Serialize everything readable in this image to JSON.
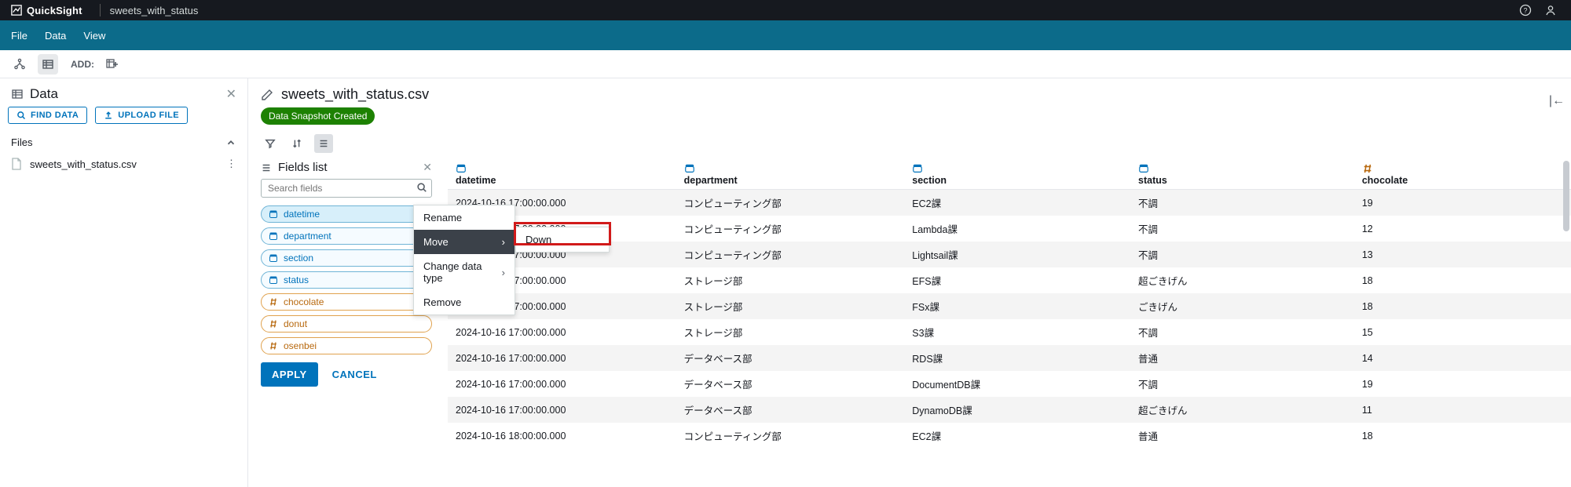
{
  "header": {
    "brand": "QuickSight",
    "dataset_name": "sweets_with_status"
  },
  "menu": {
    "file": "File",
    "data": "Data",
    "view": "View"
  },
  "toolbar": {
    "add_label": "ADD:"
  },
  "sidebar": {
    "title": "Data",
    "find_btn": "FIND DATA",
    "upload_btn": "UPLOAD FILE",
    "files_section": "Files",
    "file_name": "sweets_with_status.csv"
  },
  "content": {
    "filename": "sweets_with_status.csv",
    "badge": "Data Snapshot Created",
    "fields_title": "Fields list",
    "search_placeholder": "Search fields",
    "apply": "APPLY",
    "cancel": "CANCEL"
  },
  "fields": [
    {
      "name": "datetime",
      "kind": "date",
      "selected": true
    },
    {
      "name": "department",
      "kind": "date",
      "selected": false
    },
    {
      "name": "section",
      "kind": "date",
      "selected": false
    },
    {
      "name": "status",
      "kind": "date",
      "selected": false
    },
    {
      "name": "chocolate",
      "kind": "measure",
      "selected": false
    },
    {
      "name": "donut",
      "kind": "measure",
      "selected": false
    },
    {
      "name": "osenbei",
      "kind": "measure",
      "selected": false
    }
  ],
  "ctx_menu": {
    "rename": "Rename",
    "move": "Move",
    "change_type": "Change data type",
    "remove": "Remove",
    "submenu_down": "Down"
  },
  "table": {
    "columns": [
      {
        "name": "datetime",
        "kind": "date"
      },
      {
        "name": "department",
        "kind": "date"
      },
      {
        "name": "section",
        "kind": "date"
      },
      {
        "name": "status",
        "kind": "date"
      },
      {
        "name": "chocolate",
        "kind": "measure"
      }
    ],
    "rows": [
      [
        "2024-10-16 17:00:00.000",
        "コンピューティング部",
        "EC2課",
        "不調",
        "19"
      ],
      [
        "2024-10-16 17:00:00.000",
        "コンピューティング部",
        "Lambda課",
        "不調",
        "12"
      ],
      [
        "2024-10-16 17:00:00.000",
        "コンピューティング部",
        "Lightsail課",
        "不調",
        "13"
      ],
      [
        "2024-10-16 17:00:00.000",
        "ストレージ部",
        "EFS課",
        "超ごきげん",
        "18"
      ],
      [
        "2024-10-16 17:00:00.000",
        "ストレージ部",
        "FSx課",
        "ごきげん",
        "18"
      ],
      [
        "2024-10-16 17:00:00.000",
        "ストレージ部",
        "S3課",
        "不調",
        "15"
      ],
      [
        "2024-10-16 17:00:00.000",
        "データベース部",
        "RDS課",
        "普通",
        "14"
      ],
      [
        "2024-10-16 17:00:00.000",
        "データベース部",
        "DocumentDB課",
        "不調",
        "19"
      ],
      [
        "2024-10-16 17:00:00.000",
        "データベース部",
        "DynamoDB課",
        "超ごきげん",
        "11"
      ],
      [
        "2024-10-16 18:00:00.000",
        "コンピューティング部",
        "EC2課",
        "普通",
        "18"
      ]
    ]
  }
}
